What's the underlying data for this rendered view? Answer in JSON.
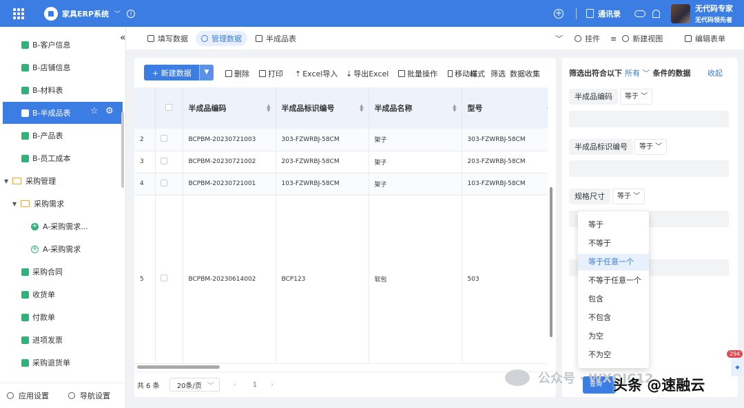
{
  "app": {
    "name": "家具ERP系统",
    "contacts_label": "通讯录",
    "user_name": "无代码专家",
    "user_subtitle": "无代码领先者"
  },
  "sidebar": {
    "items": [
      {
        "label": "B-客户信息"
      },
      {
        "label": "B-店铺信息"
      },
      {
        "label": "B-材料表"
      },
      {
        "label": "B-半成品表",
        "active": true
      },
      {
        "label": "B-产品表"
      },
      {
        "label": "B-员工成本"
      },
      {
        "label": "采购管理"
      },
      {
        "label": "采购需求"
      },
      {
        "label": "A-采购需求..."
      },
      {
        "label": "A-采购需求"
      },
      {
        "label": "采购合同"
      },
      {
        "label": "收货单"
      },
      {
        "label": "付款单"
      },
      {
        "label": "进项发票"
      },
      {
        "label": "采购退货单"
      }
    ],
    "bottom": {
      "app_settings": "应用设置",
      "nav_settings": "导航设置"
    }
  },
  "tabs": [
    {
      "label": "填写数据"
    },
    {
      "label": "管理数据",
      "active": true
    },
    {
      "label": "半成品表"
    }
  ],
  "tab_actions": {
    "plugin": "挂件",
    "new_view": "新建视图",
    "edit_form": "编辑表单"
  },
  "toolbar": {
    "new_data": "+ 新建数据",
    "delete": "删除",
    "print": "打印",
    "excel_import": "Excel导入",
    "export_excel": "导出Excel",
    "batch": "批量操作",
    "move": "移动端",
    "styles": "样式",
    "filter": "筛选",
    "data_collect": "数据收集"
  },
  "table": {
    "columns": [
      "半成品编码",
      "半成品标识编号",
      "半成品名称",
      "型号"
    ],
    "rows": [
      {
        "num": "2",
        "code": "BCPBM-20230721003",
        "ident": "303-FZWRBJ-58CM",
        "name": "架子",
        "model": "303-FZWRBJ-58CM"
      },
      {
        "num": "3",
        "code": "BCPBM-20230721002",
        "ident": "203-FZWRBJ-58CM",
        "name": "架子",
        "model": "203-FZWRBJ-58CM"
      },
      {
        "num": "4",
        "code": "BCPBM-20230721001",
        "ident": "103-FZWRBJ-58CM",
        "name": "架子",
        "model": "103-FZWRBJ-58CM"
      },
      {
        "num": "5",
        "code": "BCPBM-20230614002",
        "ident": "BCP123",
        "name": "软包",
        "model": "503"
      }
    ]
  },
  "pagination": {
    "total": "共 6 条",
    "page_size": "20条/页",
    "current_page": "1"
  },
  "filter": {
    "prefix": "筛选出符合以下",
    "mode": "所有",
    "suffix": "条件的数据",
    "collapse": "收起",
    "fields": [
      {
        "label": "半成品编码",
        "op": "等于"
      },
      {
        "label": "半成品标识编号",
        "op": "等于"
      },
      {
        "label": "规格尺寸",
        "op": "等于"
      }
    ],
    "query_button": "查询"
  },
  "dropdown": {
    "options": [
      "等于",
      "不等于",
      "等于任意一个",
      "不等于任意一个",
      "包含",
      "不包含",
      "为空",
      "不为空"
    ],
    "selected": "等于任意一个"
  },
  "badge_count": "294",
  "watermark": {
    "official": "公众号 · WXQJC12",
    "toutiao": "头条 @速融云"
  },
  "colors": {
    "primary": "#3b7de3",
    "green": "#2fb37a",
    "folder": "#f2a33a"
  }
}
